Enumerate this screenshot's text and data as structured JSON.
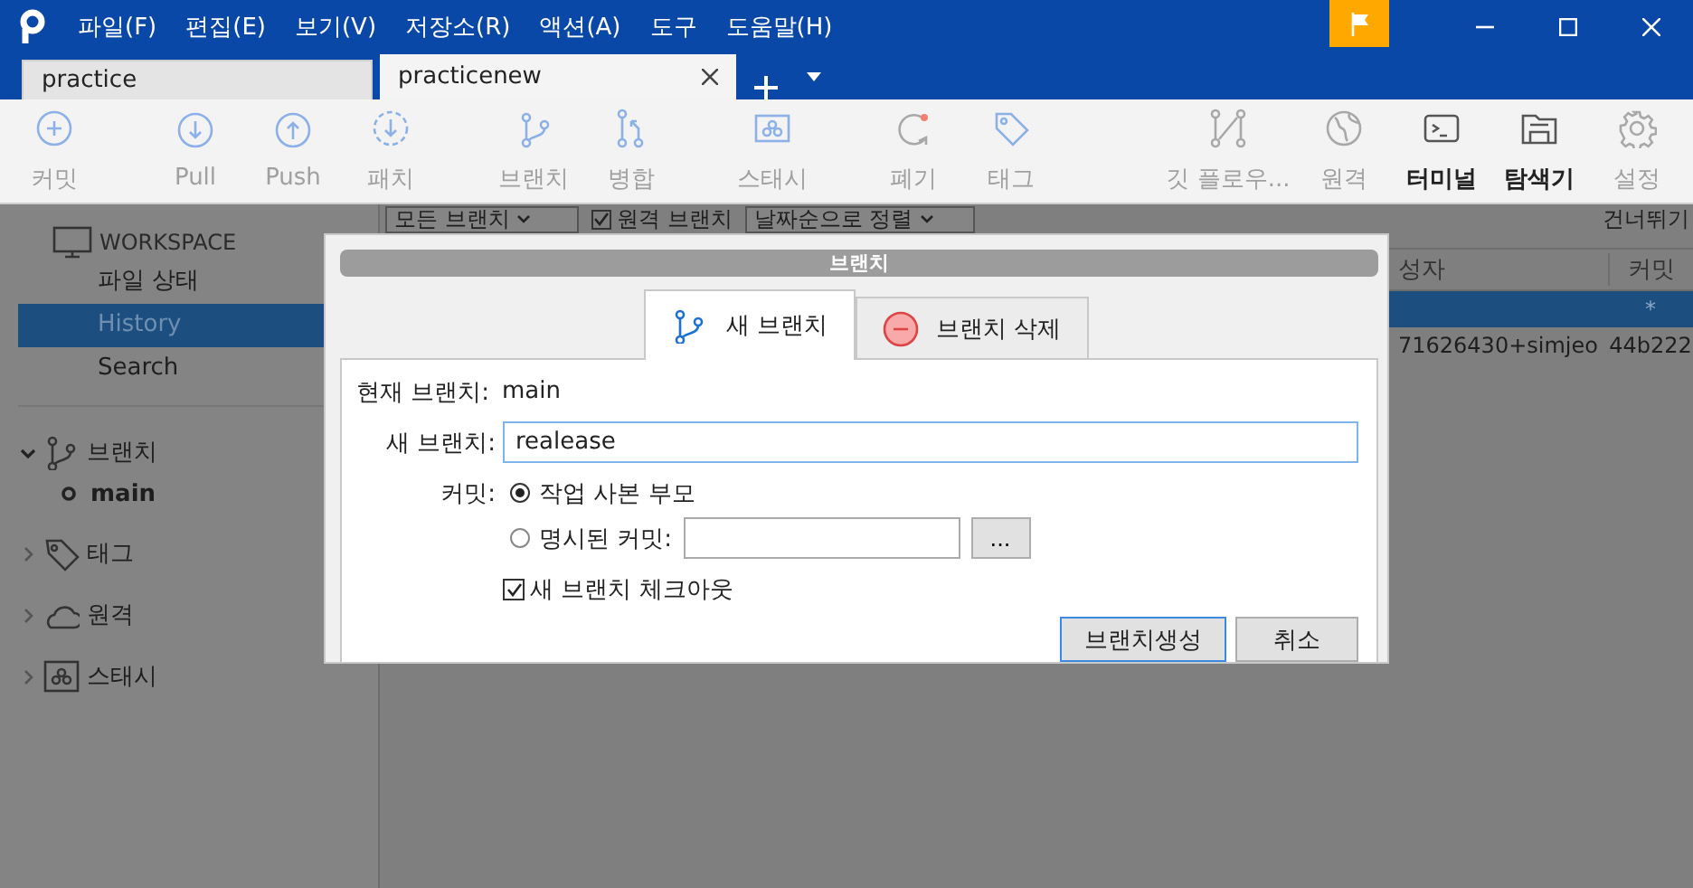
{
  "menu": [
    "파일(F)",
    "편집(E)",
    "보기(V)",
    "저장소(R)",
    "액션(A)",
    "도구",
    "도움말(H)"
  ],
  "repo_tabs": [
    {
      "label": "practice",
      "selected": false
    },
    {
      "label": "practicenew",
      "selected": true
    }
  ],
  "toolbar": [
    {
      "label": "커밋",
      "disabled": true
    },
    {
      "label": "Pull",
      "disabled": true
    },
    {
      "label": "Push",
      "disabled": true
    },
    {
      "label": "패치",
      "disabled": true
    },
    {
      "label": "브랜치",
      "disabled": true
    },
    {
      "label": "병합",
      "disabled": true
    },
    {
      "label": "스태시",
      "disabled": true
    },
    {
      "label": "폐기",
      "disabled": true
    },
    {
      "label": "태그",
      "disabled": true
    },
    {
      "label": "깃 플로우...",
      "disabled": true
    },
    {
      "label": "원격",
      "disabled": true
    },
    {
      "label": "터미널",
      "disabled": false
    },
    {
      "label": "탐색기",
      "disabled": false
    },
    {
      "label": "설정",
      "disabled": true
    }
  ],
  "sidebar": {
    "workspace": "WORKSPACE",
    "nav": [
      {
        "label": "파일 상태",
        "selected": false
      },
      {
        "label": "History",
        "selected": true
      },
      {
        "label": "Search",
        "selected": false
      }
    ],
    "sections": [
      {
        "label": "브랜치",
        "expanded": true,
        "children": [
          {
            "label": "main"
          }
        ]
      },
      {
        "label": "태그",
        "expanded": false
      },
      {
        "label": "원격",
        "expanded": false
      },
      {
        "label": "스태시",
        "expanded": false
      }
    ]
  },
  "filter_bar": {
    "branch_filter": "모든 브랜치",
    "remote_branches": {
      "label": "원격 브랜치",
      "checked": true
    },
    "sort": "날짜순으로 정렬",
    "skip": "건너뛰기"
  },
  "table": {
    "columns": [
      "성자",
      "커밋"
    ],
    "rows": [
      {
        "selected": true,
        "commit": "*"
      },
      {
        "selected": false,
        "author": "71626430+simjeo",
        "commit": "44b222"
      }
    ]
  },
  "dialog": {
    "title": "브랜치",
    "tabs": [
      {
        "label": "새 브랜치",
        "selected": true
      },
      {
        "label": "브랜치 삭제",
        "selected": false
      }
    ],
    "current_branch_label": "현재 브랜치:",
    "current_branch": "main",
    "new_branch_label": "새 브랜치:",
    "new_branch": "realease",
    "commit_label": "커밋:",
    "commit_options": [
      {
        "label": "작업 사본 부모",
        "selected": true
      },
      {
        "label": "명시된 커밋:",
        "selected": false
      }
    ],
    "browse_button": "...",
    "checkout": {
      "label": "새 브랜치 체크아웃",
      "checked": true
    },
    "buttons": [
      {
        "label": "브랜치생성",
        "default": true
      },
      {
        "label": "취소",
        "default": false
      }
    ]
  }
}
